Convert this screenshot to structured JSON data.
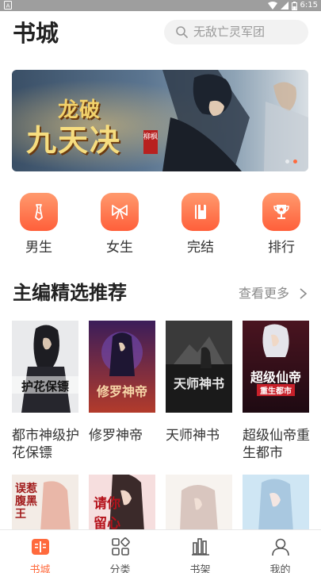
{
  "status_bar": {
    "time": "6:15",
    "battery": "8"
  },
  "header": {
    "title": "书城"
  },
  "search": {
    "placeholder": "无敌亡灵军团"
  },
  "banner": {
    "title_line1": "龙破",
    "title_line2": "九天决",
    "seal_text": "柳枫",
    "slide_count": 2,
    "active_slide": 2
  },
  "categories": [
    {
      "label": "男生",
      "icon": "tie-icon"
    },
    {
      "label": "女生",
      "icon": "bow-icon"
    },
    {
      "label": "完结",
      "icon": "book-icon"
    },
    {
      "label": "排行",
      "icon": "trophy-icon"
    }
  ],
  "section": {
    "title": "主编精选推荐",
    "more_label": "查看更多"
  },
  "books": [
    {
      "name": "都市神级护花保镖",
      "cover_text": "护花保镖"
    },
    {
      "name": "修罗神帝",
      "cover_text": "修罗神帝"
    },
    {
      "name": "天师神书",
      "cover_text": "天师神书"
    },
    {
      "name": "超级仙帝重生都市",
      "cover_text": "超级仙帝",
      "cover_subtext": "重生都市"
    }
  ],
  "books_row2": [
    {
      "cover_text": "误惹腹黑王"
    },
    {
      "cover_text": "请你留心"
    },
    {
      "cover_text": ""
    },
    {
      "cover_text": ""
    }
  ],
  "tabbar": [
    {
      "label": "书城",
      "active": true
    },
    {
      "label": "分类",
      "active": false
    },
    {
      "label": "书架",
      "active": false
    },
    {
      "label": "我的",
      "active": false
    }
  ],
  "colors": {
    "accent": "#ff6a3d",
    "icon_gradient_top": "#ff9a6e",
    "icon_gradient_bottom": "#ff5f3a"
  }
}
